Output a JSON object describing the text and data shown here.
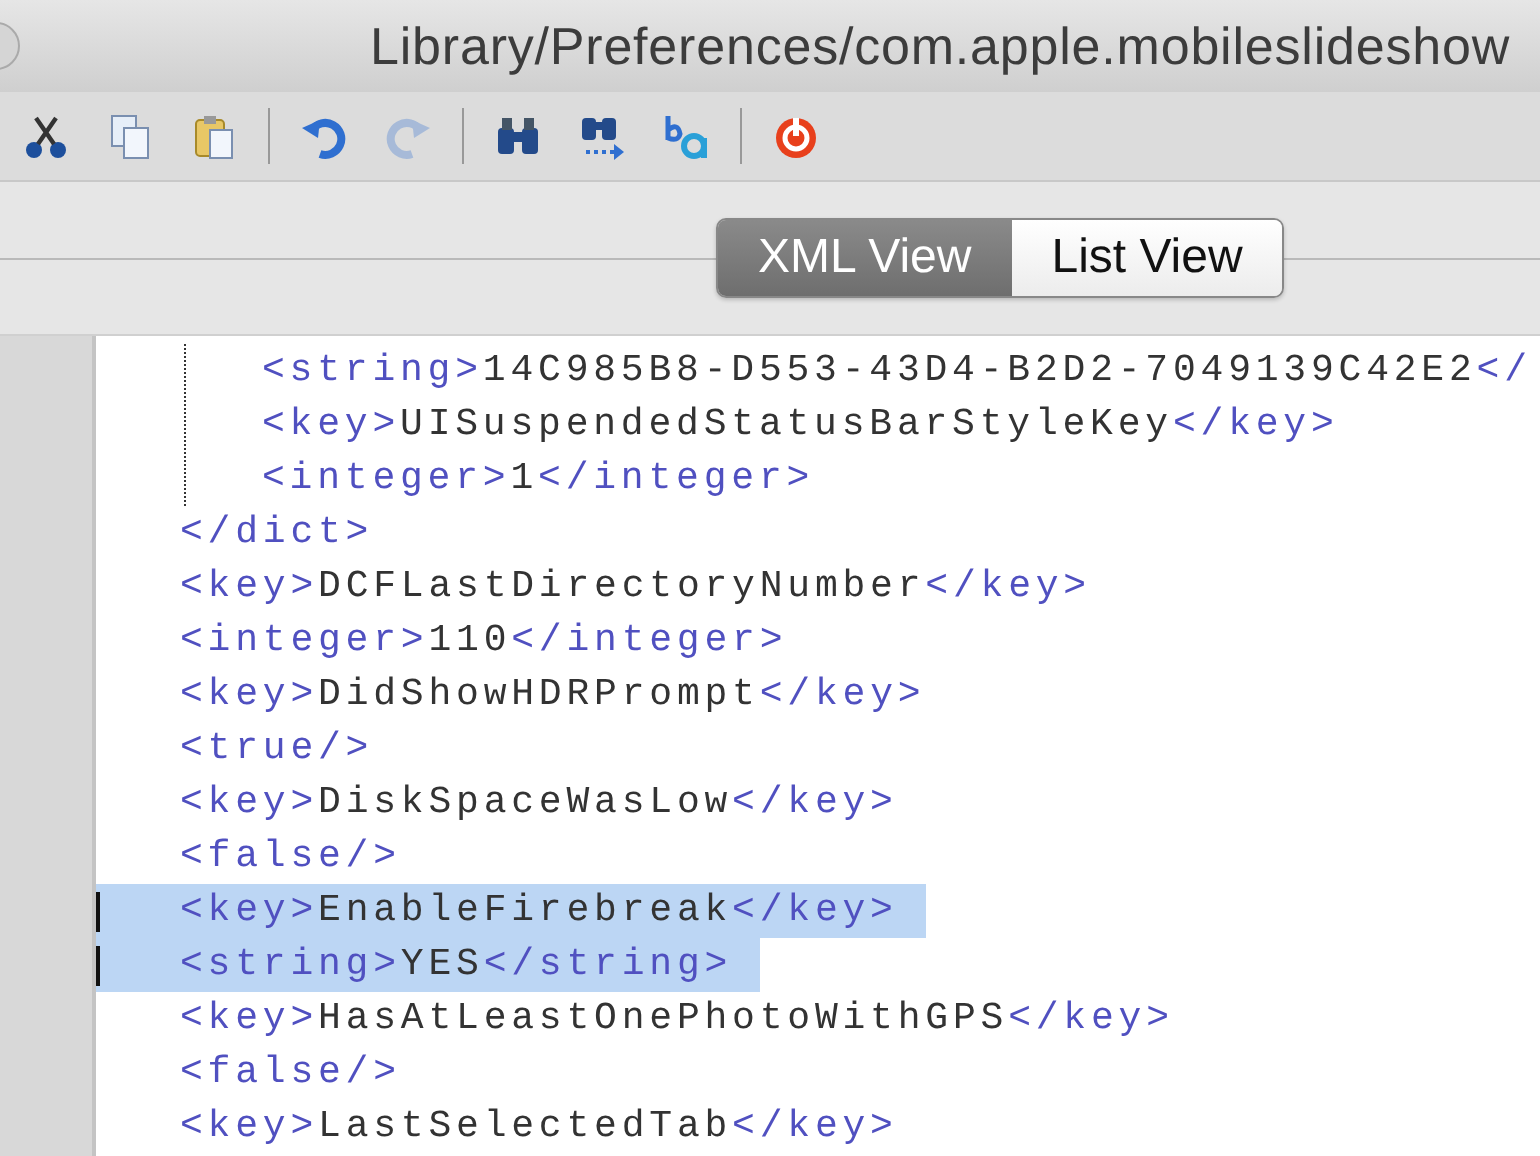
{
  "window": {
    "title": "Library/Preferences/com.apple.mobileslideshow"
  },
  "toolbar": {
    "groups": [
      [
        {
          "kind": "cut",
          "disabled": false
        },
        {
          "kind": "copy",
          "disabled": false
        },
        {
          "kind": "paste",
          "disabled": false
        }
      ],
      [
        {
          "kind": "undo",
          "disabled": false
        },
        {
          "kind": "redo",
          "disabled": true
        }
      ],
      [
        {
          "kind": "find",
          "disabled": false
        },
        {
          "kind": "find-next",
          "disabled": false
        },
        {
          "kind": "replace",
          "disabled": false
        }
      ],
      [
        {
          "kind": "quit",
          "disabled": false
        }
      ]
    ]
  },
  "view_tabs": [
    {
      "label": "XML View",
      "selected": true
    },
    {
      "label": "List View",
      "selected": false
    }
  ],
  "editor": {
    "lines": [
      {
        "kind": "block",
        "children": [
          {
            "open": "<string>",
            "text": "14C985B8-D553-43D4-B2D2-7049139C42E2",
            "close": "</",
            "selected": false
          },
          {
            "open": "<key>",
            "text": "UISuspendedStatusBarStyleKey",
            "close": "</key>",
            "selected": false
          },
          {
            "open": "<integer>",
            "text": "1",
            "close": "</integer>",
            "selected": false
          }
        ]
      },
      {
        "open": "</dict>",
        "selected": false
      },
      {
        "open": "<key>",
        "text": "DCFLastDirectoryNumber",
        "close": "</key>",
        "selected": false
      },
      {
        "open": "<integer>",
        "text": "110",
        "close": "</integer>",
        "selected": false
      },
      {
        "open": "<key>",
        "text": "DidShowHDRPrompt",
        "close": "</key>",
        "selected": false
      },
      {
        "open": "<true/>",
        "selected": false
      },
      {
        "open": "<key>",
        "text": "DiskSpaceWasLow",
        "close": "</key>",
        "selected": false
      },
      {
        "open": "<false/>",
        "selected": false
      },
      {
        "open": "<key>",
        "text": "EnableFirebreak",
        "close": "</key>",
        "selected": true
      },
      {
        "open": "<string>",
        "text": "YES",
        "close": "</string>",
        "selected": true
      },
      {
        "open": "<key>",
        "text": "HasAtLeastOnePhotoWithGPS",
        "close": "</key>",
        "selected": false
      },
      {
        "open": "<false/>",
        "selected": false
      },
      {
        "open": "<key>",
        "text": "LastSelectedTab",
        "close": "</key>",
        "selected": false
      }
    ]
  }
}
